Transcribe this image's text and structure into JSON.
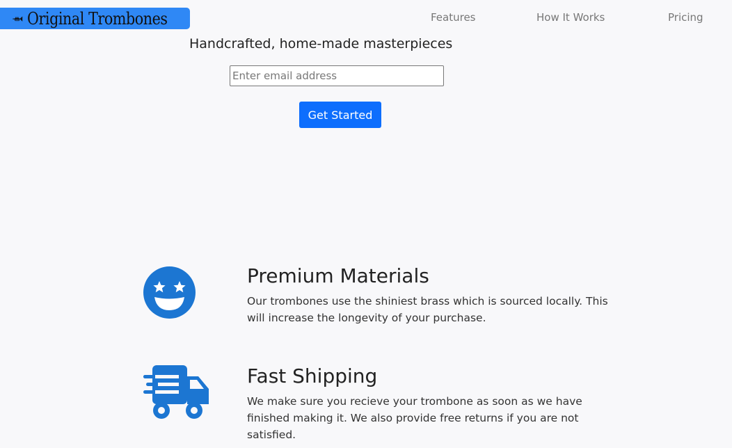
{
  "header": {
    "logo_text": "Original Trombones",
    "logo_icon": "trumpet-icon",
    "nav": {
      "features": "Features",
      "how_it_works": "How It Works",
      "pricing": "Pricing"
    }
  },
  "hero": {
    "title": "Handcrafted, home-made masterpieces",
    "email_placeholder": "Enter email address",
    "cta_label": "Get Started"
  },
  "features": [
    {
      "icon": "star-struck-face-icon",
      "title": "Premium Materials",
      "description": "Our trombones use the shiniest brass which is sourced locally. This will increase the longevity of your purchase."
    },
    {
      "icon": "shipping-truck-icon",
      "title": "Fast Shipping",
      "description": "We make sure you recieve your trombone as soon as we have finished making it. We also provide free returns if you are not satisfied."
    }
  ],
  "colors": {
    "logo_bg": "#2f88f5",
    "primary": "#0d6efd",
    "icon": "#1c76d2",
    "page_bg": "#f8f8fa"
  }
}
